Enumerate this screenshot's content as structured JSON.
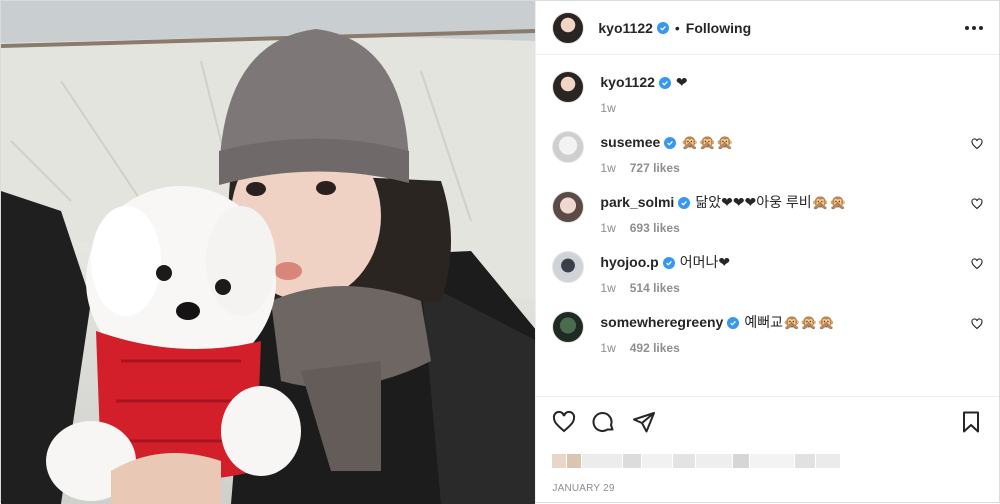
{
  "header": {
    "username": "kyo1122",
    "separator": "•",
    "follow_status": "Following"
  },
  "caption": {
    "username": "kyo1122",
    "text": "❤",
    "time": "1w"
  },
  "comments": [
    {
      "username": "susemee",
      "text": "🙊🙊🙊",
      "time": "1w",
      "likes": "727 likes"
    },
    {
      "username": "park_solmi",
      "text": "닮았❤❤❤아웅 루비🙊🙊",
      "time": "1w",
      "likes": "693 likes"
    },
    {
      "username": "hyojoo.p",
      "text": "어머나❤",
      "time": "1w",
      "likes": "514 likes"
    },
    {
      "username": "somewheregreeny",
      "text": "예뻐교🙊🙊🙊",
      "time": "1w",
      "likes": "492 likes"
    }
  ],
  "post": {
    "date": "JANUARY 29"
  },
  "colors": {
    "verified": "#3897f0",
    "text": "#262626",
    "muted": "#8e8e8e",
    "border": "#efefef"
  },
  "icons": [
    "verified-badge-icon",
    "more-options-icon",
    "heart-icon",
    "comment-icon",
    "share-icon",
    "bookmark-icon"
  ]
}
